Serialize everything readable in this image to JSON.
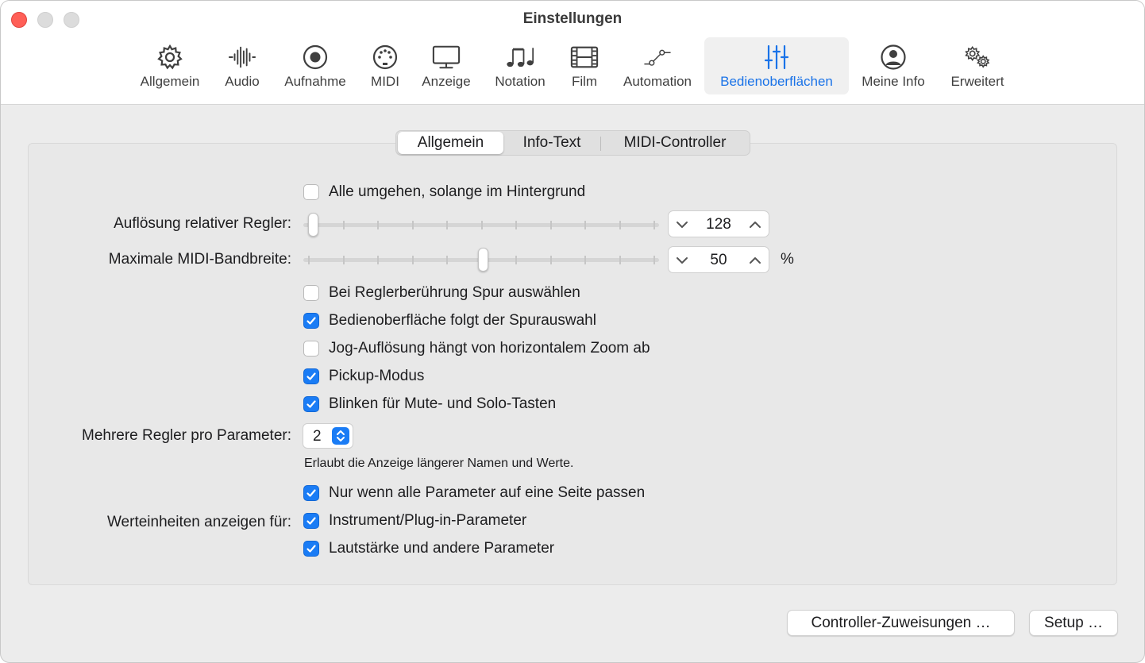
{
  "window": {
    "title": "Einstellungen"
  },
  "toolbar": {
    "items": [
      {
        "label": "Allgemein",
        "icon": "gear-icon"
      },
      {
        "label": "Audio",
        "icon": "waveform-icon"
      },
      {
        "label": "Aufnahme",
        "icon": "record-icon"
      },
      {
        "label": "MIDI",
        "icon": "midi-plug-icon"
      },
      {
        "label": "Anzeige",
        "icon": "display-icon"
      },
      {
        "label": "Notation",
        "icon": "music-notes-icon"
      },
      {
        "label": "Film",
        "icon": "film-icon"
      },
      {
        "label": "Automation",
        "icon": "automation-curve-icon"
      },
      {
        "label": "Bedienoberflächen",
        "icon": "sliders-icon"
      },
      {
        "label": "Meine Info",
        "icon": "person-icon"
      },
      {
        "label": "Erweitert",
        "icon": "gears-icon"
      }
    ],
    "active": "Bedienoberflächen",
    "active_color": "#1a73e8"
  },
  "tabs": {
    "items": [
      "Allgemein",
      "Info-Text",
      "MIDI-Controller"
    ],
    "selected": "Allgemein"
  },
  "settings": {
    "bypass_background": {
      "label": "Alle umgehen, solange im Hintergrund",
      "checked": false
    },
    "relative_resolution": {
      "label": "Auflösung relativer Regler:",
      "value": "128",
      "slider_fraction": 0.0
    },
    "max_midi_bandwidth": {
      "label": "Maximale MIDI-Bandbreite:",
      "value": "50",
      "unit": "%",
      "slider_fraction": 0.5
    },
    "checkboxes": [
      {
        "label": "Bei Reglerberührung Spur auswählen",
        "checked": false
      },
      {
        "label": "Bedienoberfläche folgt der Spurauswahl",
        "checked": true
      },
      {
        "label": "Jog-Auflösung hängt von horizontalem Zoom ab",
        "checked": false
      },
      {
        "label": "Pickup-Modus",
        "checked": true
      },
      {
        "label": "Blinken für Mute- und Solo-Tasten",
        "checked": true
      }
    ],
    "multiple_controls": {
      "label": "Mehrere Regler pro Parameter:",
      "value": "2",
      "hint": "Erlaubt die Anzeige längerer Namen und Werte.",
      "only_if_fit": {
        "label": "Nur wenn alle Parameter auf eine Seite passen",
        "checked": true
      }
    },
    "value_units": {
      "label": "Werteinheiten anzeigen für:",
      "options": [
        {
          "label": "Instrument/Plug-in-Parameter",
          "checked": true
        },
        {
          "label": "Lautstärke und andere Parameter",
          "checked": true
        }
      ]
    }
  },
  "buttons": {
    "controller_assignments": "Controller-Zuweisungen …",
    "setup": "Setup …"
  },
  "colors": {
    "accent": "#1a7cf5",
    "close": "#ff5f57"
  }
}
